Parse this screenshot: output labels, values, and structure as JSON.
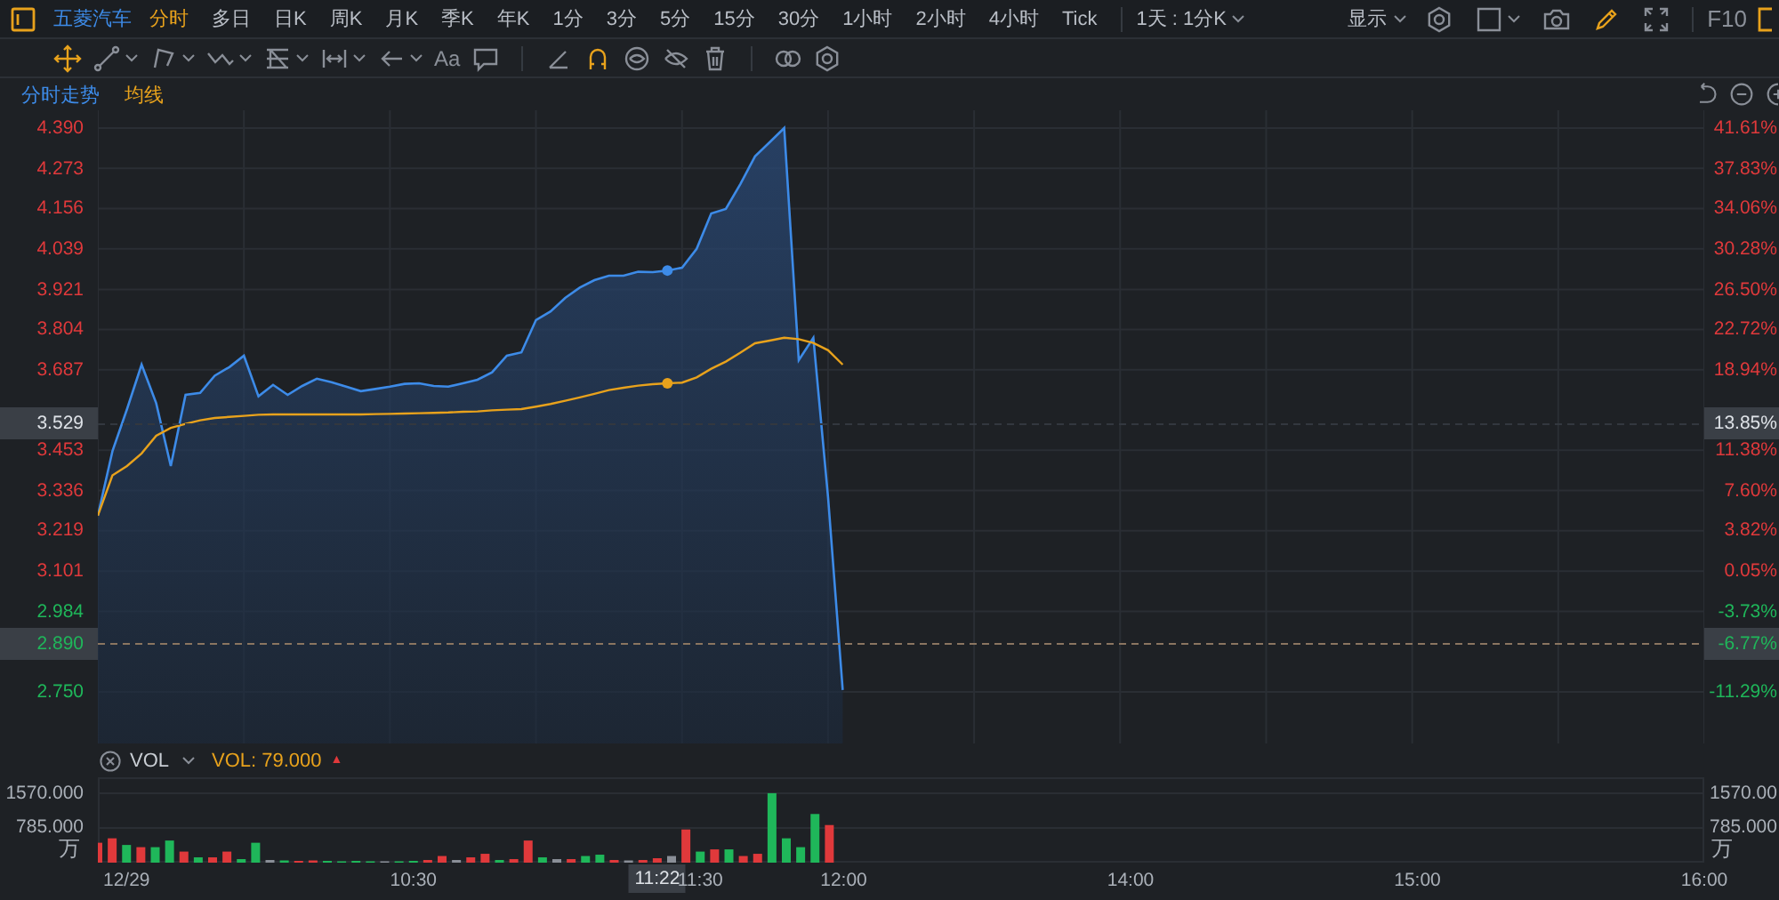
{
  "header": {
    "stock_name": "五菱汽车",
    "periods": [
      {
        "label": "分时",
        "selected": true
      },
      {
        "label": "多日",
        "selected": false
      },
      {
        "label": "日K",
        "selected": false
      },
      {
        "label": "周K",
        "selected": false
      },
      {
        "label": "月K",
        "selected": false
      },
      {
        "label": "季K",
        "selected": false
      },
      {
        "label": "年K",
        "selected": false
      },
      {
        "label": "1分",
        "selected": false
      },
      {
        "label": "3分",
        "selected": false
      },
      {
        "label": "5分",
        "selected": false
      },
      {
        "label": "15分",
        "selected": false
      },
      {
        "label": "30分",
        "selected": false
      },
      {
        "label": "1小时",
        "selected": false
      },
      {
        "label": "2小时",
        "selected": false
      },
      {
        "label": "4小时",
        "selected": false
      },
      {
        "label": "Tick",
        "selected": false
      }
    ],
    "range": "1天 : 1分K",
    "display": "显示",
    "tools": [
      {
        "kind": "gear",
        "active": false,
        "dropdown": false
      },
      {
        "kind": "checkbox",
        "active": false,
        "dropdown": true
      },
      {
        "kind": "camera",
        "active": false,
        "dropdown": false
      },
      {
        "kind": "pencil",
        "active": true,
        "dropdown": false
      },
      {
        "kind": "expand",
        "active": false,
        "dropdown": false
      }
    ],
    "f10": "F10"
  },
  "tool_groups": [
    [
      {
        "kind": "move",
        "active": true,
        "dropdown": false
      },
      {
        "kind": "segment",
        "active": false,
        "dropdown": true
      },
      {
        "kind": "polyline",
        "active": false,
        "dropdown": true
      },
      {
        "kind": "wave",
        "active": false,
        "dropdown": true
      },
      {
        "kind": "fib",
        "active": false,
        "dropdown": true
      },
      {
        "kind": "measure",
        "active": false,
        "dropdown": true
      },
      {
        "kind": "arrow",
        "active": false,
        "dropdown": true
      },
      {
        "kind": "text",
        "label": "Aa",
        "active": false,
        "dropdown": false
      },
      {
        "kind": "comment",
        "active": false,
        "dropdown": false
      }
    ],
    [
      {
        "kind": "angle",
        "active": false,
        "dropdown": false
      },
      {
        "kind": "magnet",
        "active": true,
        "dropdown": false
      },
      {
        "kind": "eye",
        "active": false,
        "dropdown": false
      },
      {
        "kind": "eyeoff",
        "active": false,
        "dropdown": false
      },
      {
        "kind": "trash",
        "active": false,
        "dropdown": false
      }
    ],
    [
      {
        "kind": "rings",
        "active": false,
        "dropdown": false
      },
      {
        "kind": "gear",
        "active": false,
        "dropdown": false
      }
    ]
  ],
  "price_panel": {
    "chart_data": {
      "type": "line",
      "grid": true,
      "ylim": [
        2.6,
        4.442
      ],
      "series": [
        {
          "name": "分时走势",
          "color": "#3d8be8",
          "values": [
            3.263,
            3.45,
            3.573,
            3.702,
            3.59,
            3.407,
            3.614,
            3.62,
            3.67,
            3.695,
            3.728,
            3.61,
            3.643,
            3.614,
            3.64,
            3.661,
            3.651,
            3.638,
            3.625,
            3.631,
            3.638,
            3.646,
            3.648,
            3.64,
            3.638,
            3.648,
            3.658,
            3.68,
            3.728,
            3.738,
            3.832,
            3.857,
            3.896,
            3.926,
            3.948,
            3.961,
            3.961,
            3.972,
            3.971,
            3.976,
            3.984,
            4.039,
            4.142,
            4.155,
            4.228,
            4.308,
            4.349,
            4.39,
            3.715,
            3.78,
            3.314,
            2.756,
            null,
            null,
            null,
            null,
            null,
            null,
            null,
            null,
            null,
            null,
            null,
            null,
            null,
            null,
            null,
            null,
            null,
            null,
            null,
            null,
            null,
            null,
            null,
            null,
            null,
            null,
            null,
            null,
            null,
            null,
            null,
            null,
            null,
            null,
            null,
            null,
            null,
            null,
            null,
            null,
            null,
            null,
            null,
            null,
            null,
            null,
            null,
            null,
            null,
            null,
            null,
            null,
            null,
            null,
            null,
            null,
            null,
            null,
            null
          ]
        },
        {
          "name": "均线",
          "color": "#e8a21c",
          "values": [
            3.263,
            3.38,
            3.407,
            3.444,
            3.495,
            3.518,
            3.53,
            3.54,
            3.547,
            3.55,
            3.553,
            3.556,
            3.557,
            3.557,
            3.557,
            3.557,
            3.557,
            3.557,
            3.557,
            3.558,
            3.559,
            3.56,
            3.561,
            3.562,
            3.563,
            3.565,
            3.566,
            3.569,
            3.571,
            3.573,
            3.58,
            3.588,
            3.597,
            3.607,
            3.617,
            3.628,
            3.635,
            3.641,
            3.645,
            3.648,
            3.65,
            3.665,
            3.69,
            3.711,
            3.737,
            3.764,
            3.772,
            3.78,
            3.776,
            3.765,
            3.744,
            3.702,
            null,
            null,
            null,
            null,
            null,
            null,
            null,
            null,
            null,
            null,
            null,
            null,
            null,
            null,
            null,
            null,
            null,
            null,
            null,
            null,
            null,
            null,
            null,
            null,
            null,
            null,
            null,
            null,
            null,
            null,
            null,
            null,
            null,
            null,
            null,
            null,
            null,
            null,
            null,
            null,
            null,
            null,
            null,
            null,
            null,
            null,
            null,
            null,
            null,
            null,
            null,
            null,
            null,
            null,
            null,
            null,
            null,
            null,
            null
          ]
        }
      ],
      "yticks": [
        {
          "value": 4.39,
          "label": "4.390"
        },
        {
          "value": 4.273,
          "label": "4.273"
        },
        {
          "value": 4.156,
          "label": "4.156"
        },
        {
          "value": 4.039,
          "label": "4.039"
        },
        {
          "value": 3.921,
          "label": "3.921"
        },
        {
          "value": 3.804,
          "label": "3.804"
        },
        {
          "value": 3.687,
          "label": "3.687"
        },
        {
          "value": 3.453,
          "label": "3.453"
        },
        {
          "value": 3.336,
          "label": "3.336"
        },
        {
          "value": 3.219,
          "label": "3.219"
        },
        {
          "value": 3.101,
          "label": "3.101"
        },
        {
          "value": 2.984,
          "label": "2.984"
        },
        {
          "value": 2.75,
          "label": "2.750"
        }
      ],
      "ref_lines": [
        {
          "axis": "y",
          "value": 3.529,
          "label": "3.529"
        },
        {
          "axis": "y",
          "value": 2.89,
          "label": "2.890"
        }
      ]
    },
    "badges": [
      {
        "label": "13.85%",
        "kind": "crosshair"
      },
      {
        "label": "-6.77%",
        "kind": "last"
      }
    ],
    "right_axis": [
      {
        "label": "41.61%",
        "color": "#e0393b"
      },
      {
        "label": "37.83%",
        "color": "#e0393b"
      },
      {
        "label": "34.06%",
        "color": "#e0393b"
      },
      {
        "label": "30.28%",
        "color": "#e0393b"
      },
      {
        "label": "26.50%",
        "color": "#e0393b"
      },
      {
        "label": "22.72%",
        "color": "#e0393b"
      },
      {
        "label": "18.94%",
        "color": "#e0393b"
      },
      {
        "label": "11.38%",
        "color": "#e0393b"
      },
      {
        "label": "7.60%",
        "color": "#e0393b"
      },
      {
        "label": "3.82%",
        "color": "#e0393b"
      },
      {
        "label": "0.05%",
        "color": "#e0393b"
      },
      {
        "label": "-3.73%",
        "color": "#1fb75a"
      },
      {
        "label": "-11.29%",
        "color": "#1fb75a"
      }
    ]
  },
  "volume_panel": {
    "indicator": "VOL",
    "reading": "VOL: 79.000",
    "rising": true,
    "trend_mark": "▲",
    "unit_left": "万",
    "unit_right": "万",
    "right_labels": [
      "1570.00",
      "785.000"
    ],
    "chart_data": {
      "type": "bar",
      "grid": true,
      "ylim": [
        0,
        1930
      ],
      "categories": [
        null,
        null,
        "12/29",
        null,
        null,
        null,
        null,
        null,
        null,
        null,
        null,
        null,
        null,
        null,
        null,
        null,
        null,
        null,
        null,
        null,
        null,
        null,
        "10:30",
        null,
        null,
        null,
        null,
        null,
        null,
        null,
        null,
        null,
        null,
        null,
        null,
        null,
        null,
        null,
        null,
        "11:22",
        null,
        null,
        "11:30",
        null,
        null,
        null,
        null,
        null,
        null,
        null,
        null,
        null,
        "12:00",
        null,
        null,
        null,
        null,
        null,
        null,
        null,
        null,
        null,
        null,
        null,
        null,
        null,
        null,
        null,
        null,
        null,
        null,
        null,
        "14:00",
        null,
        null,
        null,
        null,
        null,
        null,
        null,
        null,
        null,
        null,
        null,
        null,
        null,
        null,
        null,
        null,
        null,
        null,
        null,
        "15:00",
        null,
        null,
        null,
        null,
        null,
        null,
        null,
        null,
        null,
        null,
        null,
        null,
        null,
        null,
        null,
        null,
        null,
        null,
        null,
        "16:00"
      ],
      "series": [
        {
          "color": "#e0393b",
          "values": [
            450,
            550,
            null,
            350,
            null,
            null,
            250,
            null,
            120,
            250,
            null,
            null,
            null,
            null,
            40,
            50,
            null,
            null,
            null,
            null,
            null,
            null,
            null,
            60,
            150,
            null,
            120,
            200,
            null,
            80,
            500,
            null,
            null,
            80,
            null,
            null,
            60,
            null,
            60,
            100,
            null,
            750,
            null,
            300,
            null,
            150,
            200,
            null,
            null,
            null,
            null,
            850,
            null,
            null,
            null,
            null,
            null,
            null,
            null,
            null,
            null,
            null,
            null,
            null,
            null,
            null,
            null,
            null,
            null,
            null,
            null,
            null,
            null,
            null,
            null,
            null,
            null,
            null,
            null,
            null,
            null,
            null,
            null,
            null,
            null,
            null,
            null,
            null,
            null,
            null,
            null,
            null,
            null,
            null,
            null,
            null,
            null,
            null,
            null,
            null,
            null,
            null,
            null,
            null,
            null,
            null,
            null,
            null,
            null,
            null,
            null,
            null,
            null
          ]
        },
        {
          "color": "#1fb75a",
          "values": [
            null,
            null,
            400,
            null,
            350,
            500,
            null,
            120,
            null,
            null,
            80,
            450,
            null,
            50,
            null,
            null,
            40,
            30,
            40,
            30,
            null,
            30,
            40,
            null,
            null,
            null,
            null,
            null,
            60,
            null,
            null,
            120,
            null,
            null,
            150,
            180,
            null,
            null,
            null,
            null,
            null,
            null,
            250,
            null,
            300,
            null,
            null,
            1570,
            550,
            350,
            1100,
            null,
            null,
            null,
            null,
            null,
            null,
            null,
            null,
            null,
            null,
            null,
            null,
            null,
            null,
            null,
            null,
            null,
            null,
            null,
            null,
            null,
            null,
            null,
            null,
            null,
            null,
            null,
            null,
            null,
            null,
            null,
            null,
            null,
            null,
            null,
            null,
            null,
            null,
            null,
            null,
            null,
            null,
            null,
            null,
            null,
            null,
            null,
            null,
            null,
            null,
            null,
            null,
            null,
            null,
            null,
            null,
            null,
            null,
            null,
            null,
            null,
            null
          ]
        },
        {
          "color": "#8a8f98",
          "values": [
            null,
            null,
            null,
            null,
            null,
            null,
            null,
            null,
            null,
            null,
            null,
            null,
            60,
            null,
            null,
            null,
            null,
            null,
            null,
            null,
            30,
            null,
            null,
            null,
            null,
            60,
            null,
            null,
            null,
            null,
            null,
            null,
            80,
            null,
            null,
            null,
            null,
            50,
            null,
            null,
            150,
            null,
            null,
            null,
            null,
            null,
            null,
            null,
            null,
            null,
            null,
            null,
            null,
            null,
            null,
            null,
            null,
            null,
            null,
            null,
            null,
            null,
            null,
            null,
            null,
            null,
            null,
            null,
            null,
            null,
            null,
            null,
            null,
            null,
            null,
            null,
            null,
            null,
            null,
            null,
            null,
            null,
            null,
            null,
            null,
            null,
            null,
            null,
            null,
            null,
            null,
            null,
            null,
            null,
            null,
            null,
            null,
            null,
            null,
            null,
            null,
            null,
            null,
            null,
            null,
            null,
            null,
            null,
            null,
            null,
            null,
            null,
            null
          ]
        }
      ],
      "yticks": [
        {
          "value": 1570,
          "label": "1570.000"
        },
        {
          "value": 785,
          "label": "785.000"
        }
      ],
      "annotations": [
        {
          "x": "11:22"
        }
      ]
    }
  }
}
